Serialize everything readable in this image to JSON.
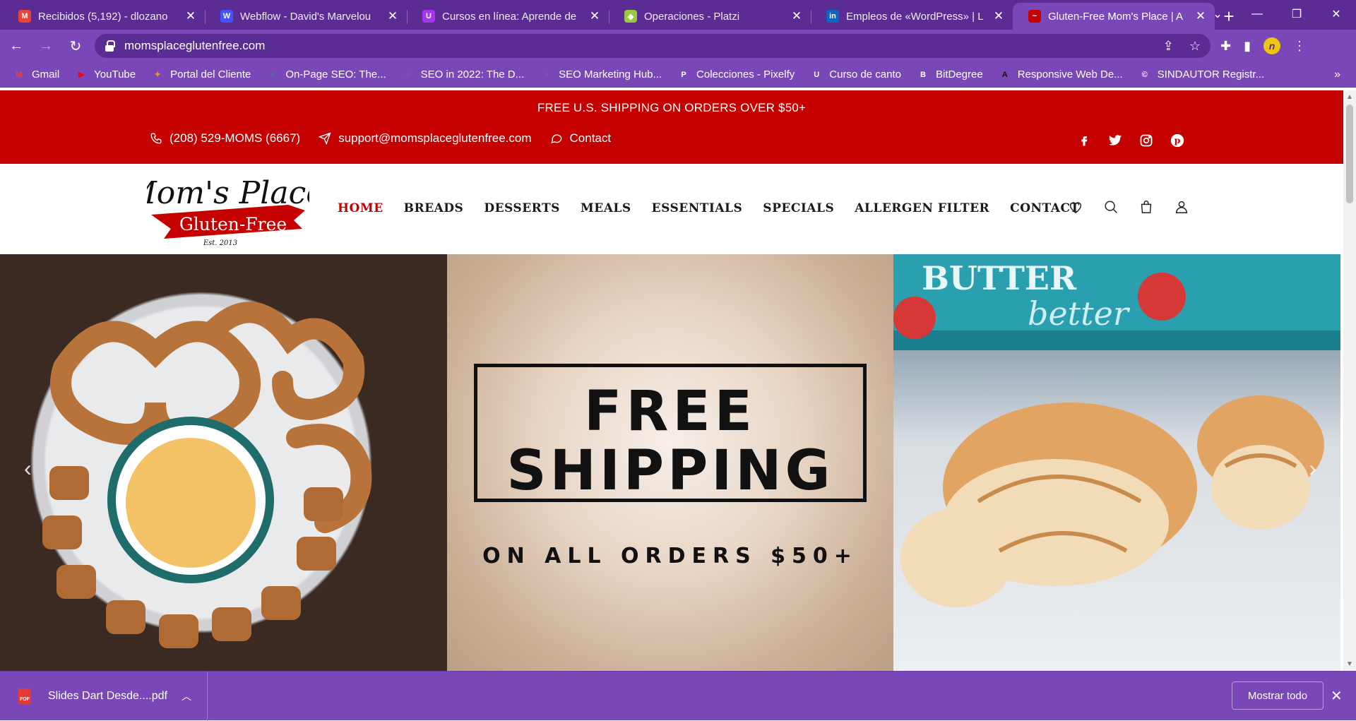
{
  "browser": {
    "tabs": [
      {
        "label": "Recibidos (5,192) - dlozano",
        "favicon": "gmail-icon",
        "color": "#ea4335",
        "glyph": "M"
      },
      {
        "label": "Webflow - David's Marvelou",
        "favicon": "webflow-icon",
        "color": "#4353ff",
        "glyph": "W"
      },
      {
        "label": "Cursos en línea: Aprende de",
        "favicon": "udemy-icon",
        "color": "#a435f0",
        "glyph": "U"
      },
      {
        "label": "Operaciones - Platzi",
        "favicon": "platzi-icon",
        "color": "#98ca3f",
        "glyph": "◆"
      },
      {
        "label": "Empleos de «WordPress» | L",
        "favicon": "linkedin-icon",
        "color": "#0a66c2",
        "glyph": "in"
      },
      {
        "label": "Gluten-Free Mom's Place | A",
        "favicon": "momsplace-icon",
        "color": "#c50000",
        "glyph": "~",
        "active": true
      }
    ],
    "new_tab": "+",
    "url": "momsplaceglutenfree.com",
    "bookmarks": [
      {
        "label": "Gmail",
        "icon": "gmail-icon",
        "color": "#ea4335",
        "glyph": "M"
      },
      {
        "label": "YouTube",
        "icon": "youtube-icon",
        "color": "#ff0000",
        "glyph": "▶"
      },
      {
        "label": "Portal del Cliente",
        "icon": "portal-icon",
        "color": "#f39c12",
        "glyph": "✦"
      },
      {
        "label": "On-Page SEO: The...",
        "icon": "seo-icon",
        "color": "#27ae60",
        "glyph": "○"
      },
      {
        "label": "SEO in 2022: The D...",
        "icon": "seo-icon",
        "color": "#27ae60",
        "glyph": "○"
      },
      {
        "label": "SEO Marketing Hub...",
        "icon": "seo-icon",
        "color": "#27ae60",
        "glyph": "○"
      },
      {
        "label": "Colecciones - Pixelfy",
        "icon": "pixelfy-icon",
        "color": "#ffffff",
        "glyph": "P"
      },
      {
        "label": "Curso de canto",
        "icon": "udemy-icon",
        "color": "#ffffff",
        "glyph": "U"
      },
      {
        "label": "BitDegree",
        "icon": "bitdegree-icon",
        "color": "#ffffff",
        "glyph": "B"
      },
      {
        "label": "Responsive Web De...",
        "icon": "responsive-icon",
        "color": "#111111",
        "glyph": "A"
      },
      {
        "label": "SINDAUTOR Registr...",
        "icon": "sindautor-icon",
        "color": "#ffffff",
        "glyph": "©"
      }
    ],
    "bookmarks_more": "»"
  },
  "site": {
    "topbar": {
      "shipping": "FREE U.S. SHIPPING ON ORDERS OVER $50+",
      "phone": "(208) 529-MOMS (6667)",
      "email": "support@momsplaceglutenfree.com",
      "contact": "Contact"
    },
    "logo": {
      "line1": "Mom's Place",
      "line2": "Gluten-Free",
      "est": "Est. 2013"
    },
    "menu": [
      "HOME",
      "BREADS",
      "DESSERTS",
      "MEALS",
      "ESSENTIALS",
      "SPECIALS",
      "ALLERGEN FILTER",
      "CONTACT"
    ],
    "active_menu": "HOME",
    "brand_color": "#c50000",
    "hero": {
      "line1": "FREE",
      "line2": "SHIPPING",
      "line3": "ON ALL ORDERS $50+",
      "butter_sign": "BUTTER better",
      "slides": 5,
      "active_slide": 1
    }
  },
  "downloads": {
    "file": "Slides Dart Desde....pdf",
    "file_type": "PDF",
    "show_all": "Mostrar todo"
  }
}
